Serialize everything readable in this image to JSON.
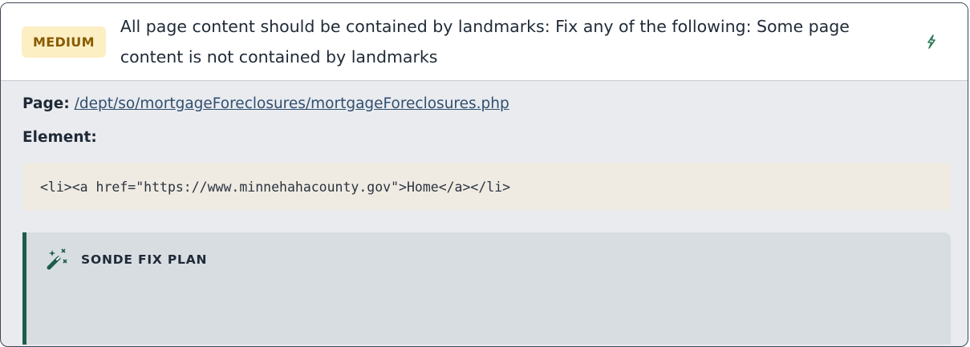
{
  "issue": {
    "severity": "MEDIUM",
    "title": "All page content should be contained by landmarks: Fix any of the following: Some page content is not contained by landmarks",
    "fix_icon": "lightning-icon"
  },
  "details": {
    "page_label": "Page:",
    "page_url": "/dept/so/mortgageForeclosures/mortgageForeclosures.php",
    "element_label": "Element:",
    "element_code": "<li><a href=\"https://www.minnehahacounty.gov\">Home</a></li>"
  },
  "fix_plan": {
    "title": "SONDE FIX PLAN",
    "icon": "magic-wand-icon"
  },
  "colors": {
    "badge_bg": "#fcefc4",
    "badge_text": "#8a5a00",
    "accent": "#1f5c4c",
    "link": "#2f4f6f"
  }
}
